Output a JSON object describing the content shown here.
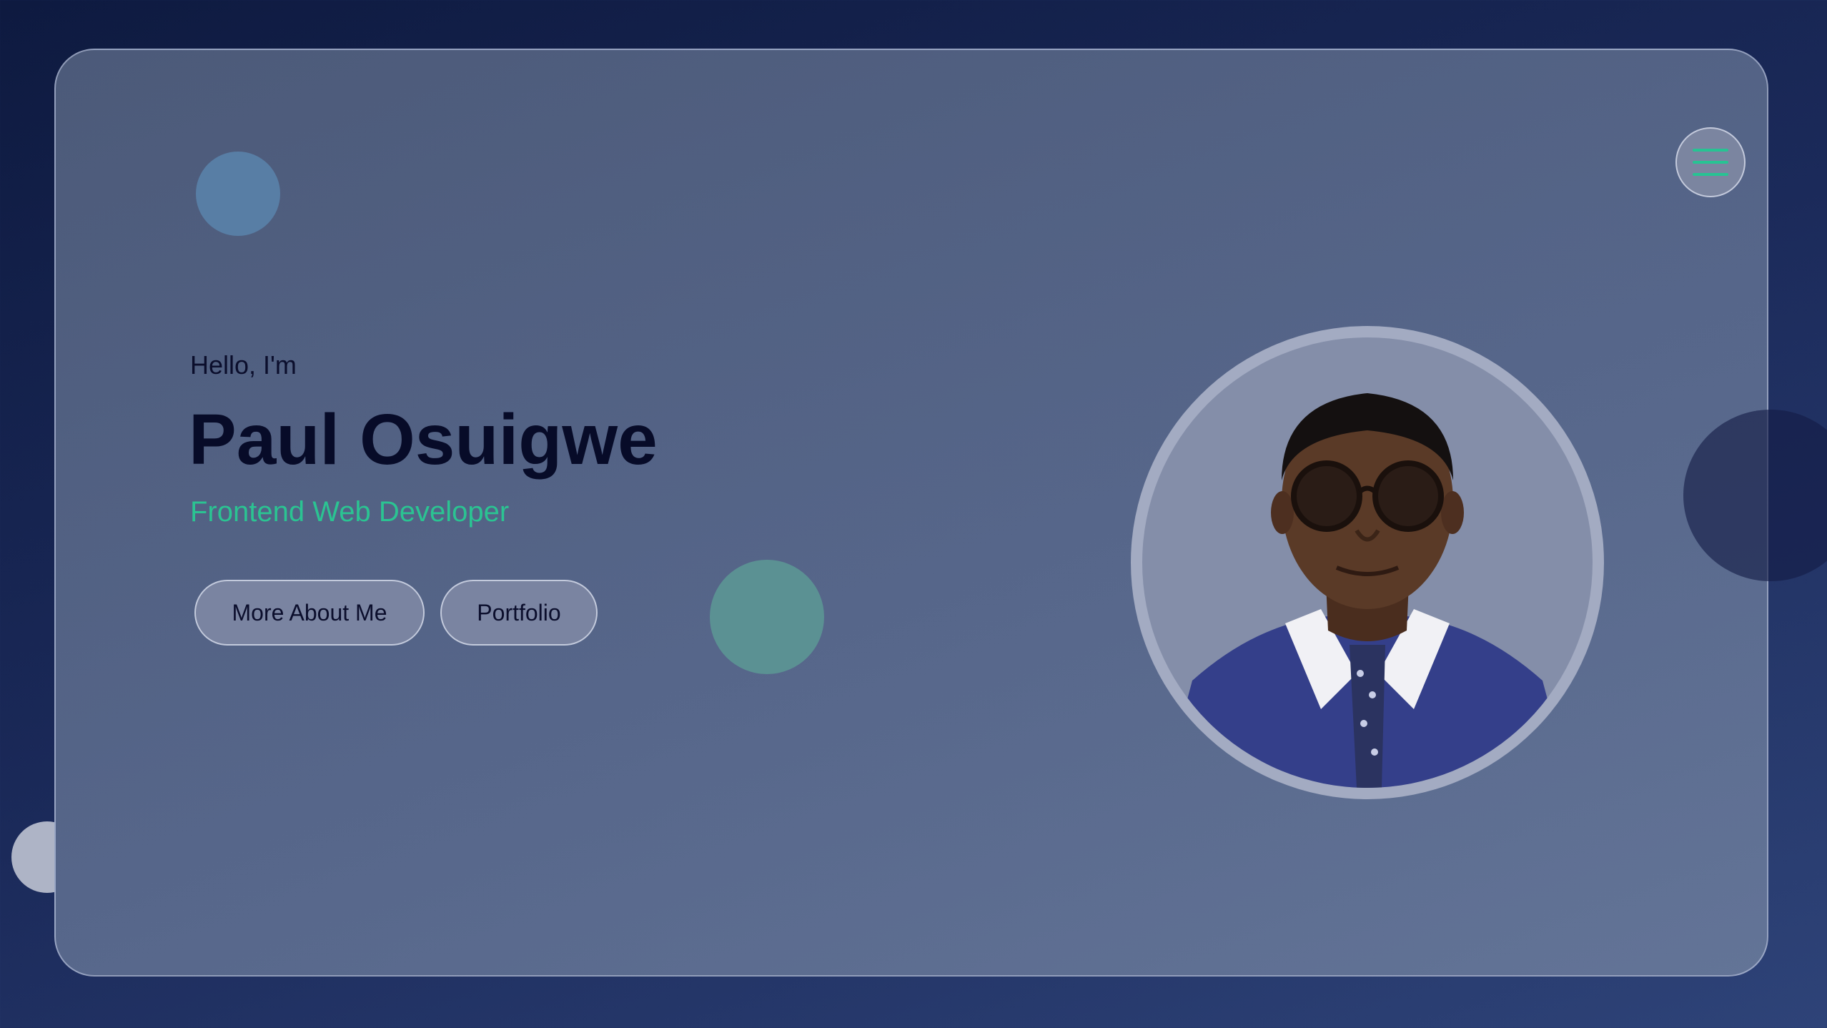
{
  "hero": {
    "greeting": "Hello, I'm",
    "name": "Paul Osuigwe",
    "role": "Frontend Web Developer"
  },
  "buttons": {
    "about_label": "More About Me",
    "portfolio_label": "Portfolio"
  },
  "nav": {
    "menu_icon": "hamburger-menu-icon"
  },
  "colors": {
    "accent": "#2bc392",
    "name_text": "#070b28",
    "background_dark": "#0e1a40",
    "card": "#56668a"
  }
}
